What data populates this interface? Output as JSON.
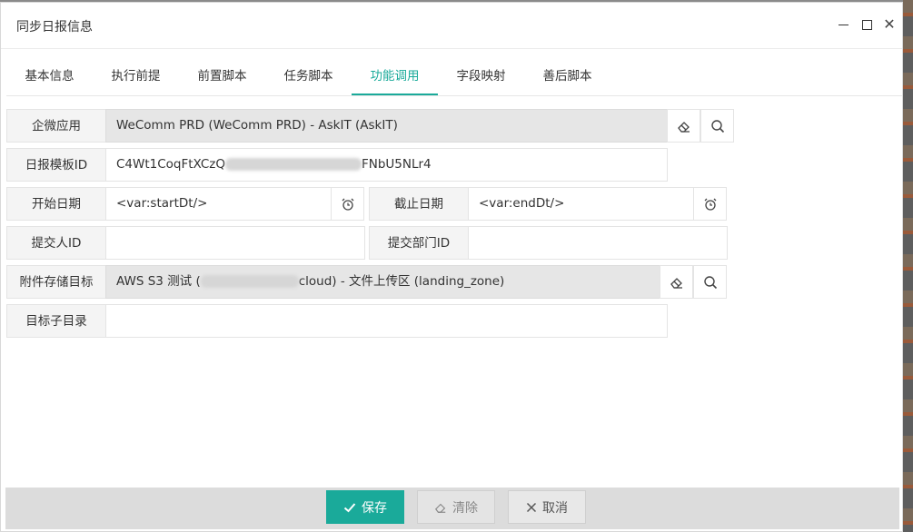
{
  "dialog": {
    "title": "同步日报信息"
  },
  "tabs": [
    {
      "label": "基本信息"
    },
    {
      "label": "执行前提"
    },
    {
      "label": "前置脚本"
    },
    {
      "label": "任务脚本"
    },
    {
      "label": "功能调用",
      "active": true
    },
    {
      "label": "字段映射"
    },
    {
      "label": "善后脚本"
    }
  ],
  "form": {
    "wecom_app": {
      "label": "企微应用",
      "value": "WeComm PRD (WeComm PRD) - AskIT (AskIT)"
    },
    "template_id": {
      "label": "日报模板ID",
      "value_prefix": "C4Wt1CoqFtXCzQ",
      "value_suffix": "FNbU5NLr4"
    },
    "start_date": {
      "label": "开始日期",
      "value": "<var:startDt/>"
    },
    "end_date": {
      "label": "截止日期",
      "value": "<var:endDt/>"
    },
    "submitter_id": {
      "label": "提交人ID",
      "value": ""
    },
    "submit_dept_id": {
      "label": "提交部门ID",
      "value": ""
    },
    "attachment_target": {
      "label": "附件存储目标",
      "value_prefix": "AWS S3 测试 (",
      "value_suffix": "cloud) - 文件上传区 (landing_zone)"
    },
    "target_subdir": {
      "label": "目标子目录",
      "value": ""
    }
  },
  "footer": {
    "save_label": "保存",
    "clear_label": "清除",
    "cancel_label": "取消"
  },
  "colors": {
    "accent": "#1aaa9a",
    "readonly_bg": "#e6e6e6"
  }
}
